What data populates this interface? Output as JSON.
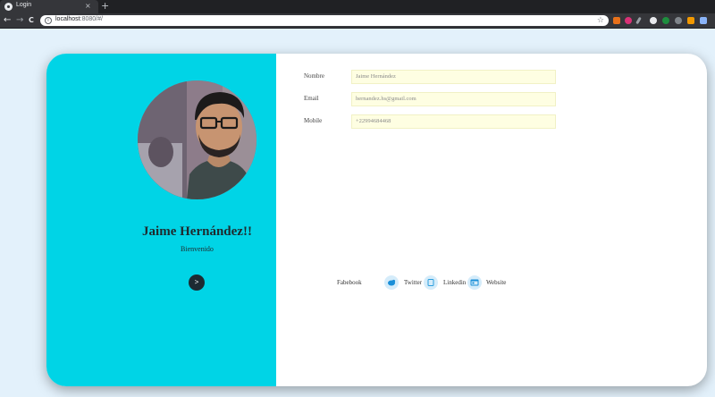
{
  "browser": {
    "tab_title": "Login",
    "tab_close": "×",
    "new_tab": "+",
    "url_host": "localhost",
    "url_rest": ":8080/#/",
    "info": "i",
    "star": "☆",
    "nav_back": "←",
    "nav_forward": "→",
    "nav_reload": "C"
  },
  "profile": {
    "name": "Jaime Hernández!!",
    "welcome": "Bienvenido",
    "next_label": ">"
  },
  "form": {
    "fields": [
      {
        "label": "Nombre",
        "value": "Jaime Hernández"
      },
      {
        "label": "Email",
        "value": "hernandez.hs@gmail.com"
      },
      {
        "label": "Mobile",
        "value": "+22994684468"
      }
    ]
  },
  "social": [
    {
      "label": "Fabebook",
      "icon": "facebook-icon"
    },
    {
      "label": "Twitter",
      "icon": "twitter-icon"
    },
    {
      "label": "Linkedin",
      "icon": "linkedin-icon"
    },
    {
      "label": "Website",
      "icon": "website-icon"
    }
  ],
  "colors": {
    "left_panel": "#00d4e6",
    "page_background": "#e3f1fb",
    "input_background": "#fefee2",
    "button": "#1d2b32"
  }
}
